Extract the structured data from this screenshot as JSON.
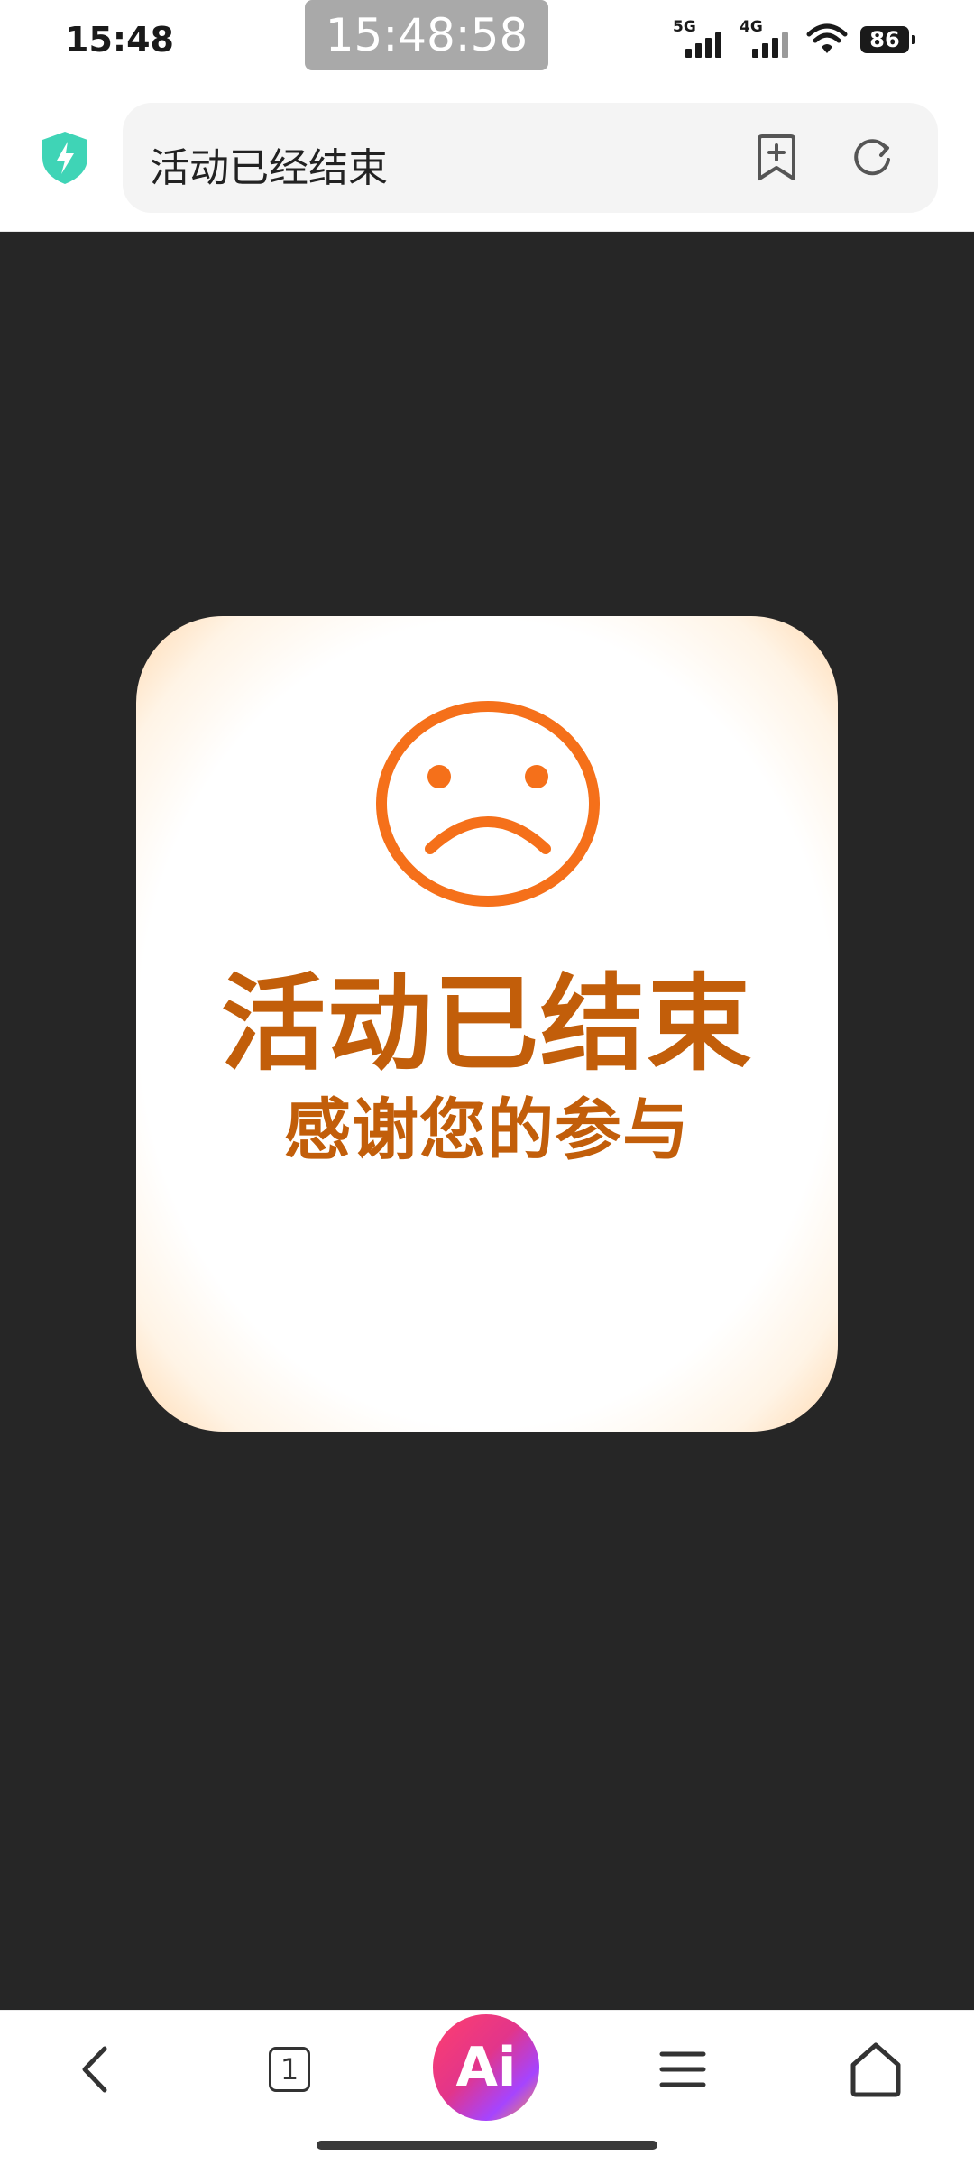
{
  "status_bar": {
    "time": "15:48",
    "clock_badge": "15:48:58",
    "network_1": "5G",
    "network_2": "4G",
    "battery": "86"
  },
  "address_bar": {
    "page_title": "活动已经结束",
    "icons": [
      "shield-bolt-icon",
      "bookmark-add-icon",
      "refresh-icon"
    ]
  },
  "notice": {
    "title": "活动已结束",
    "subtitle": "感谢您的参与",
    "icon": "sad-face-icon"
  },
  "toolbar": {
    "tab_count": "1",
    "ai_label": "Ai",
    "icons": [
      "back-icon",
      "tabs-icon",
      "ai-icon",
      "menu-icon",
      "home-icon"
    ]
  },
  "colors": {
    "content_background": "#262626",
    "notice_text": "#c25e0a",
    "face_orange": "#f5701a",
    "shield_teal": "#3fd4b6"
  }
}
